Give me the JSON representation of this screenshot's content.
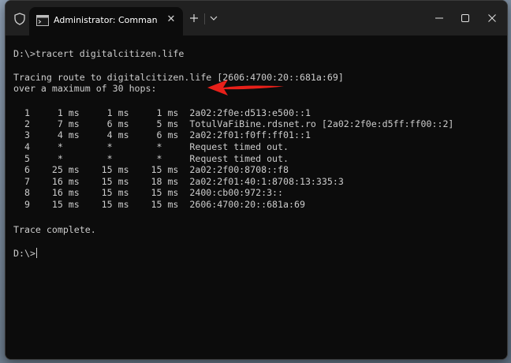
{
  "window": {
    "tab_title": "Administrator: Command Pro",
    "tab_close": "✕",
    "icons": [
      "shield-icon",
      "terminal-icon",
      "close-icon",
      "plus-icon",
      "chevron-down-icon",
      "minimize-icon",
      "maximize-icon",
      "close-icon"
    ]
  },
  "console": {
    "command_line": "D:\\>tracert digitalcitizen.life",
    "tracing_line": "Tracing route to digitalcitizen.life [2606:4700:20::681a:69]",
    "max_hops_line": "over a maximum of 30 hops:",
    "hops": [
      "  1     1 ms     1 ms     1 ms  2a02:2f0e:d513:e500::1",
      "  2     7 ms     6 ms     5 ms  TotulVaFiBine.rdsnet.ro [2a02:2f0e:d5ff:ff00::2]",
      "  3     4 ms     4 ms     6 ms  2a02:2f01:f0ff:ff01::1",
      "  4     *        *        *     Request timed out.",
      "  5     *        *        *     Request timed out.",
      "  6    25 ms    15 ms    15 ms  2a02:2f00:8708::f8",
      "  7    16 ms    15 ms    18 ms  2a02:2f01:40:1:8708:13:335:3",
      "  8    16 ms    15 ms    15 ms  2400:cb00:972:3::",
      "  9    15 ms    15 ms    15 ms  2606:4700:20::681a:69"
    ],
    "complete_line": "Trace complete.",
    "prompt": "D:\\>"
  },
  "colors": {
    "console_background": "#0c0c0c",
    "console_text": "#cccccc",
    "titlebar": "#202020",
    "annotation_arrow": "#e8201a"
  }
}
